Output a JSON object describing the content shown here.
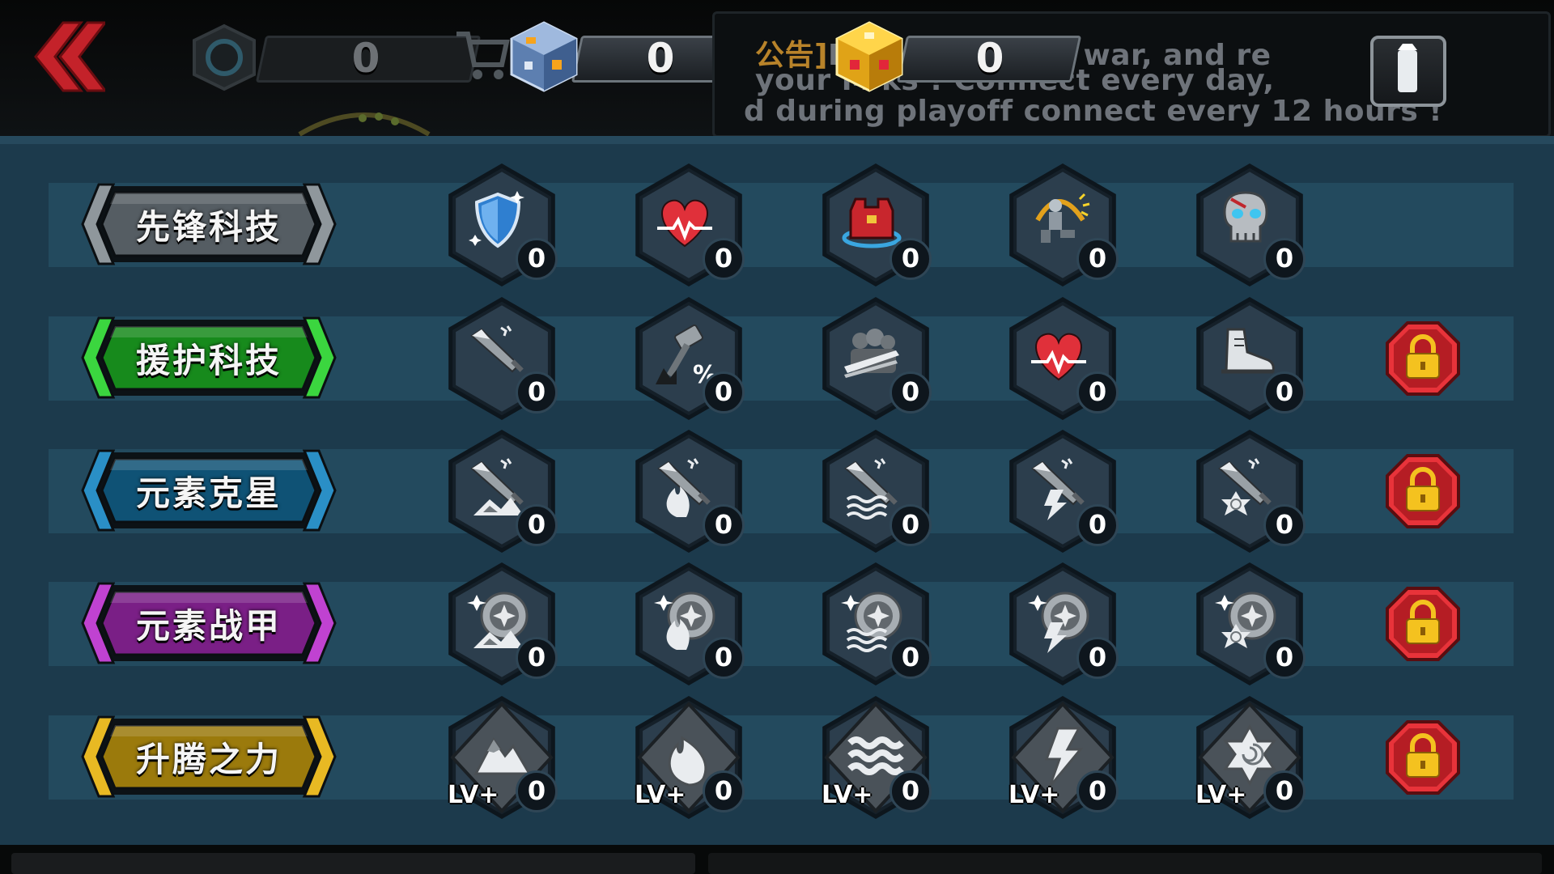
{
  "top_bar": {
    "back_icon": "double-chevron-left-icon",
    "resources": [
      {
        "name": "gear-token",
        "icon": "gear-coin-icon",
        "value": "0"
      },
      {
        "name": "blue-cube",
        "icon": "blue-cube-icon",
        "value": "0"
      },
      {
        "name": "gold-cube",
        "icon": "gold-cube-icon",
        "value": "0"
      }
    ],
    "notice": {
      "tag": "公告]",
      "line1": "H                   n inter-guild war, and re",
      "line2": "your M                   ks ! Connect every day,",
      "line3": "d during playoff connect every 12 hours !"
    },
    "info_icon": "info-icon"
  },
  "categories": [
    {
      "label": "先锋科技",
      "color": "#555d63",
      "accent": "#8f979c",
      "locked": false,
      "icons": [
        "shield-icon",
        "heart-pulse-icon",
        "armor-vest-icon",
        "kneeling-soldier-icon",
        "skull-icon"
      ],
      "counts": [
        "0",
        "0",
        "0",
        "0",
        "0"
      ]
    },
    {
      "label": "援护科技",
      "color": "#178a1c",
      "accent": "#3bd63f",
      "locked": true,
      "icons": [
        "sword-icon",
        "hammer-percent-icon",
        "crowd-sword-icon",
        "heart-pulse-icon",
        "sneaker-icon"
      ],
      "counts": [
        "0",
        "0",
        "0",
        "0",
        "0"
      ]
    },
    {
      "label": "元素克星",
      "color": "#0f5275",
      "accent": "#2a8fc6",
      "locked": true,
      "icons": [
        "sword-earth-icon",
        "sword-fire-icon",
        "sword-water-icon",
        "sword-lightning-icon",
        "sword-wind-icon"
      ],
      "counts": [
        "0",
        "0",
        "0",
        "0",
        "0"
      ]
    },
    {
      "label": "元素战甲",
      "color": "#7a1f86",
      "accent": "#c042d1",
      "locked": true,
      "icons": [
        "shield-earth-icon",
        "shield-fire-icon",
        "shield-water-icon",
        "shield-lightning-icon",
        "shield-wind-icon"
      ],
      "counts": [
        "0",
        "0",
        "0",
        "0",
        "0"
      ]
    },
    {
      "label": "升腾之力",
      "color": "#9b7a0c",
      "accent": "#e8b923",
      "locked": true,
      "icons": [
        "earth-lvup-icon",
        "fire-lvup-icon",
        "water-lvup-icon",
        "lightning-lvup-icon",
        "wind-lvup-icon"
      ],
      "counts": [
        "0",
        "0",
        "0",
        "0",
        "0"
      ],
      "badge": "LV+"
    }
  ],
  "lock_icon": "padlock-icon"
}
